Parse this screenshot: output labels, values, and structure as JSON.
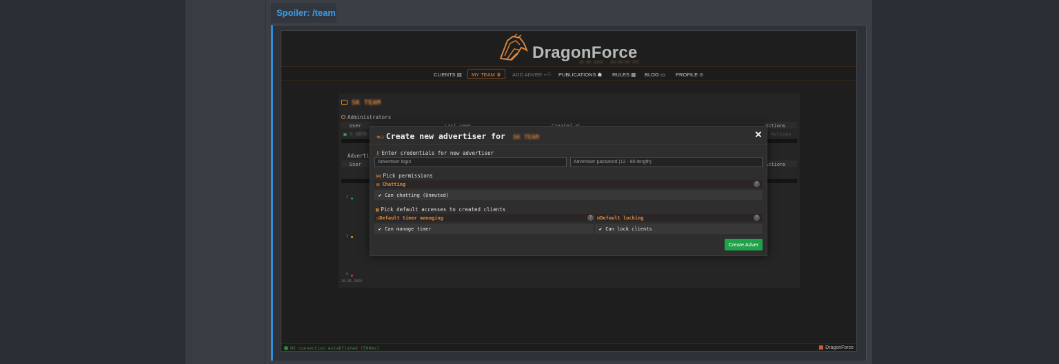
{
  "spoiler": {
    "label": "Spoiler: /team"
  },
  "app": {
    "brand": "DragonForce",
    "date_line": "26.06.2026 · 04:00:00 UTC",
    "nav": [
      {
        "label": "CLIENTS ▤"
      },
      {
        "label": "MY TEAM ♛"
      },
      {
        "label": "ADD ADVER +⚇"
      },
      {
        "label": "PUBLICATIONS ☗"
      },
      {
        "label": "RULES ▦"
      },
      {
        "label": "BLOG ▭"
      },
      {
        "label": "PROFILE ⊙"
      }
    ],
    "footer_status": "WS connection established (500ms)",
    "footer_brand": "DragonForce",
    "colors": {
      "accent": "#e08a3a",
      "success": "#1fa34a",
      "spoiler_accent": "#2d8fe0"
    }
  },
  "background": {
    "team_title": "SK TEAM",
    "administrators_label": "Administrators",
    "advertisers_label": "Adverti",
    "col_user": "User",
    "col_last_seen": "Last seen",
    "col_created_at": "Created at",
    "col_actions": "Actions",
    "admin_row_name": "V_2870",
    "admin_row_action": "Actions",
    "chart_y_2": "2",
    "chart_y_1": "1",
    "chart_y_0": "0",
    "chart_date": "26.06.2024"
  },
  "modal": {
    "title": "Create new advertiser for",
    "title_target": "SK TEAM",
    "credentials_label": "Enter credentials for new advertiser",
    "login_placeholder": "Advertiser login",
    "password_placeholder": "Advertiser password (12 - 80 length)",
    "permissions_label": "Pick permissions",
    "chatting_header": "Chatting",
    "chatting_option": "Can chatting (Unmuted)",
    "accesses_label": "Pick default accesses to created clients",
    "timer_header": "Default timer managing",
    "timer_option": "Can manage timer",
    "locking_header": "Default locking",
    "locking_option": "Can lock clients",
    "create_button": "Create Adver",
    "help_glyph": "?"
  }
}
